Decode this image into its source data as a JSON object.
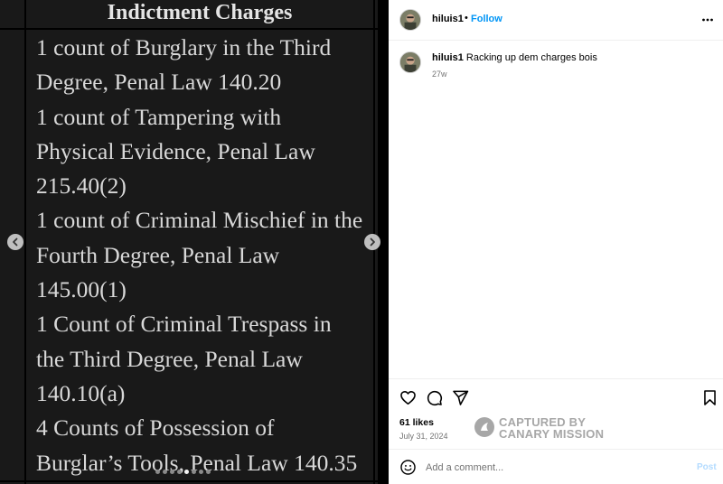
{
  "post_image": {
    "title": "Indictment Charges",
    "lines": [
      "1 count of Burglary in the Third",
      "Degree, Penal Law 140.20",
      "1 count of Tampering with",
      "Physical Evidence, Penal Law",
      "215.40(2)",
      "1 count of Criminal Mischief in the",
      "Fourth Degree, Penal Law",
      "145.00(1)",
      "1 Count of Criminal Trespass in",
      "the Third Degree, Penal Law",
      "140.10(a)",
      "4 Counts of Possession of",
      "Burglar’s Tools, Penal Law 140.35"
    ],
    "carousel_dots": 8,
    "active_dot_index": 4,
    "prev_icon": "chevron-left-icon",
    "next_icon": "chevron-right-icon"
  },
  "header": {
    "username": "hiluis1",
    "separator": "•",
    "follow_label": "Follow",
    "more_icon": "more-horizontal-icon"
  },
  "caption": {
    "username": "hiluis1",
    "text": "Racking up dem charges bois",
    "time": "27w"
  },
  "actions": {
    "icons": [
      "heart-icon",
      "comment-icon",
      "share-icon",
      "bookmark-icon"
    ],
    "likes": "61 likes",
    "date": "July 31, 2024"
  },
  "watermark": {
    "line1": "CAPTURED BY",
    "line2": "CANARY MISSION"
  },
  "comment": {
    "placeholder": "Add a comment...",
    "post_label": "Post",
    "emoji_icon": "emoji-icon"
  },
  "colors": {
    "follow": "#0095f6",
    "post_disabled": "#b3dbff",
    "muted": "#737373",
    "image_bg": "#191919"
  }
}
